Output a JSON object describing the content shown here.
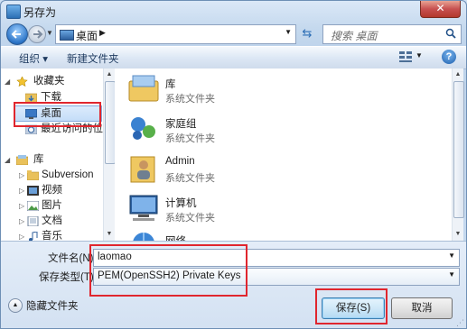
{
  "window": {
    "title": "另存为",
    "close_glyph": "✕"
  },
  "address": {
    "location": "桌面",
    "search_placeholder": "搜索 桌面"
  },
  "toolbar": {
    "organize": "组织 ▾",
    "new_folder": "新建文件夹",
    "help": "?"
  },
  "navpane": {
    "items": [
      {
        "label": "收藏夹",
        "icon": "star-icon"
      },
      {
        "label": "下载",
        "icon": "download-folder-icon"
      },
      {
        "label": "桌面",
        "icon": "desktop-icon",
        "selected": true
      },
      {
        "label": "最近访问的位置",
        "icon": "recent-places-icon"
      },
      {
        "label": "库",
        "icon": "library-icon"
      },
      {
        "label": "Subversion",
        "icon": "folder-icon"
      },
      {
        "label": "视频",
        "icon": "video-library-icon"
      },
      {
        "label": "图片",
        "icon": "picture-library-icon"
      },
      {
        "label": "文档",
        "icon": "document-library-icon"
      },
      {
        "label": "音乐",
        "icon": "music-library-icon"
      }
    ]
  },
  "files": [
    {
      "name": "库",
      "type": "系统文件夹",
      "icon": "library-folder-icon"
    },
    {
      "name": "家庭组",
      "type": "系统文件夹",
      "icon": "homegroup-icon"
    },
    {
      "name": "Admin",
      "type": "系统文件夹",
      "icon": "user-folder-icon"
    },
    {
      "name": "计算机",
      "type": "系统文件夹",
      "icon": "computer-icon"
    },
    {
      "name": "网络",
      "type": "",
      "icon": "network-icon"
    }
  ],
  "form": {
    "filename_label": "文件名(N):",
    "filename_value": "laomao",
    "filetype_label": "保存类型(T):",
    "filetype_value": "PEM(OpenSSH2) Private Keys",
    "hide_folders": "隐藏文件夹",
    "save": "保存(S)",
    "cancel": "取消"
  },
  "colors": {
    "highlight": "#e0262e",
    "selection": "#c4ddf8",
    "window_frame": "#c5d9ee"
  }
}
